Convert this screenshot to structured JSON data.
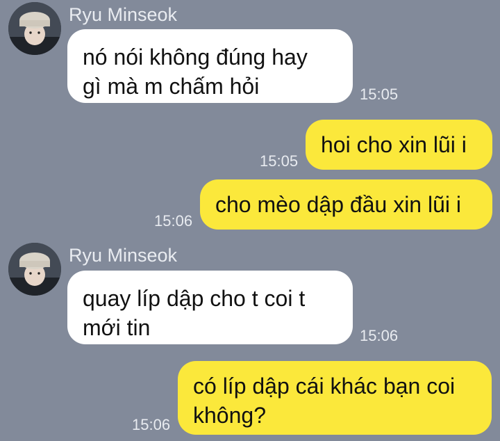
{
  "messages": [
    {
      "sender": "Ryu Minseok",
      "lines": [
        "nó nói không đúng hay",
        "gì mà m chấm hỏi"
      ],
      "time": "15:05"
    },
    {
      "lines": [
        "hoi cho xin lũi i"
      ],
      "time": "15:05"
    },
    {
      "lines": [
        "cho mèo dập đầu xin lũi i"
      ],
      "time": "15:06"
    },
    {
      "sender": "Ryu Minseok",
      "lines": [
        "quay líp dập cho t coi t",
        "mới tin"
      ],
      "time": "15:06"
    },
    {
      "lines": [
        "có líp dập cái khác bạn coi",
        "không?"
      ],
      "time": "15:06"
    }
  ],
  "colors": {
    "background": "#828a9a",
    "incoming_bubble": "#ffffff",
    "outgoing_bubble": "#fbe83b"
  },
  "icons": {
    "avatar": "profile-photo"
  }
}
